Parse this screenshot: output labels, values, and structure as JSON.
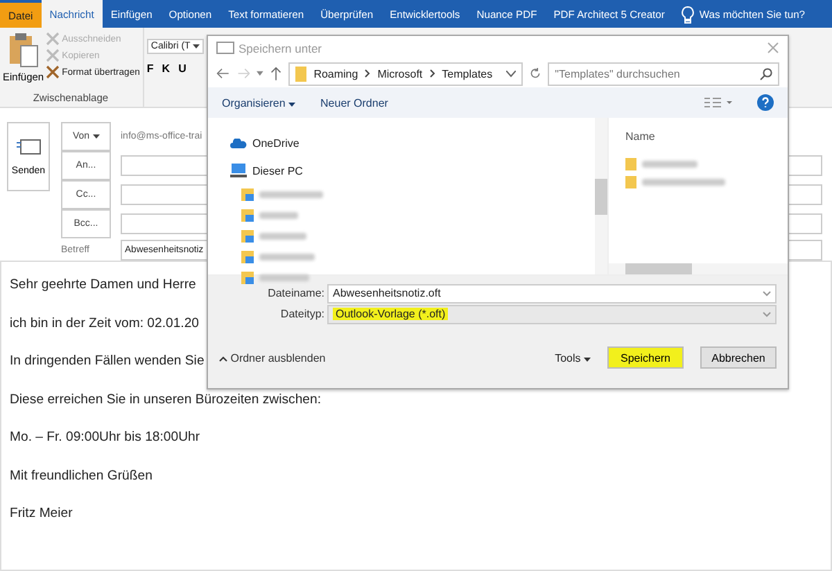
{
  "tabs": [
    {
      "label": "Datei",
      "kind": "file",
      "selected": false
    },
    {
      "label": "Nachricht",
      "kind": "tab",
      "selected": true
    },
    {
      "label": "Einfügen",
      "kind": "tab",
      "selected": false
    },
    {
      "label": "Optionen",
      "kind": "tab",
      "selected": false
    },
    {
      "label": "Text formatieren",
      "kind": "tab",
      "selected": false
    },
    {
      "label": "Überprüfen",
      "kind": "tab",
      "selected": false
    },
    {
      "label": "Entwicklertools",
      "kind": "tab",
      "selected": false
    },
    {
      "label": "Nuance PDF",
      "kind": "tab",
      "selected": false
    },
    {
      "label": "PDF Architect 5 Creator",
      "kind": "tab",
      "selected": false
    }
  ],
  "tell_me": "Was möchten Sie tun?",
  "clipboard": {
    "paste": "Einfügen",
    "actions": [
      {
        "label": "Ausschneiden",
        "disabled": true
      },
      {
        "label": "Kopieren",
        "disabled": true
      },
      {
        "label": "Format übertragen",
        "disabled": false
      }
    ],
    "group_label": "Zwischenablage"
  },
  "font": {
    "name": "Calibri (T",
    "buttons": [
      "F",
      "K",
      "U"
    ]
  },
  "compose": {
    "send": "Senden",
    "from_button": "Von",
    "from_value": "info@ms-office-trai",
    "recipients": [
      "An...",
      "Cc...",
      "Bcc..."
    ],
    "subject_label": "Betreff",
    "subject": "Abwesenheitsnotiz"
  },
  "body": [
    "Sehr geehrte Damen und Herre",
    "ich bin in der Zeit vom: 02.01.20",
    "In dringenden Fällen wenden Sie",
    "Diese erreichen Sie in unseren Bürozeiten zwischen:",
    "Mo. – Fr. 09:00Uhr bis 18:00Uhr",
    "Mit freundlichen Grüßen",
    "Fritz Meier"
  ],
  "dialog": {
    "title": "Speichern unter",
    "path": [
      "Roaming",
      "Microsoft",
      "Templates"
    ],
    "search": {
      "placeholder": "\"Templates\" durchsuchen"
    },
    "toolbar": {
      "organize": "Organisieren",
      "new_folder": "Neuer Ordner"
    },
    "nav": [
      {
        "label": "OneDrive",
        "kind": "cloud"
      },
      {
        "label": "Dieser PC",
        "kind": "pc"
      }
    ],
    "nav_blurred_count_items": [
      {
        "kind": "folder"
      },
      {
        "kind": "folder"
      },
      {
        "kind": "folder"
      },
      {
        "kind": "folder"
      },
      {
        "kind": "folder"
      }
    ],
    "column": "Name",
    "files": [
      {
        "kind": "folder"
      },
      {
        "kind": "folder"
      }
    ],
    "filename_label": "Dateiname:",
    "filename": "Abwesenheitsnotiz.oft",
    "filetype_label": "Dateityp:",
    "filetype": "Outlook-Vorlage (*.oft)",
    "filetype_highlighted": true,
    "hide_folders": "Ordner ausblenden",
    "tools": "Tools",
    "save": "Speichern",
    "save_highlighted": true,
    "cancel": "Abbrechen"
  }
}
